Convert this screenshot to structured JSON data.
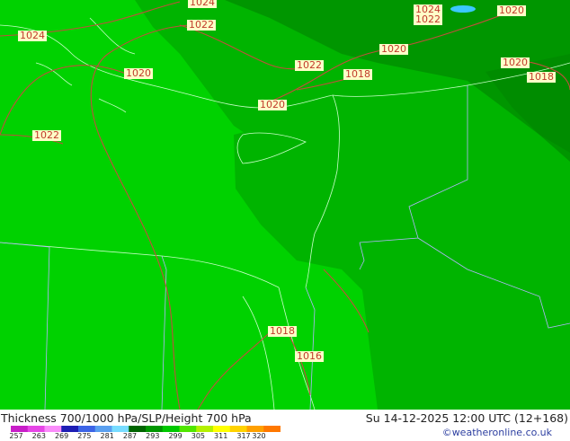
{
  "title": "Thickness 700/1000 hPa/SLP/Height 700 hPa",
  "valid_time": "Su 14-12-2025 12:00 UTC (12+168)",
  "credit": "©weatheronline.co.uk",
  "colors": {
    "land_light": "#00d200",
    "land_mid": "#00b400",
    "land_dark": "#009600",
    "isobar": "#c0503c",
    "border": "#b4b4ff",
    "label_bg": "#ffffc8",
    "label_text": "#c0392b"
  },
  "isobar_labels": [
    {
      "text": "1024",
      "pos": "top-left"
    },
    {
      "text": "1024",
      "pos": "top-center"
    },
    {
      "text": "1022",
      "pos": "top-center"
    },
    {
      "text": "1020",
      "pos": "top-left"
    },
    {
      "text": "1022",
      "pos": "left"
    },
    {
      "text": "1022",
      "pos": "upper-center"
    },
    {
      "text": "1020",
      "pos": "upper-center"
    },
    {
      "text": "1018",
      "pos": "upper-center"
    },
    {
      "text": "1020",
      "pos": "upper-right"
    },
    {
      "text": "1024",
      "pos": "top-right"
    },
    {
      "text": "1022",
      "pos": "top-right"
    },
    {
      "text": "1020",
      "pos": "top-right"
    },
    {
      "text": "1020",
      "pos": "right"
    },
    {
      "text": "1018",
      "pos": "right"
    },
    {
      "text": "1018",
      "pos": "bottom"
    },
    {
      "text": "1016",
      "pos": "bottom"
    }
  ],
  "scale": {
    "ticks": [
      "257",
      "263",
      "269",
      "275",
      "281",
      "287",
      "293",
      "299",
      "305",
      "311",
      "317",
      "320"
    ],
    "colors": [
      "#c81ec8",
      "#e646e6",
      "#fa8cfa",
      "#1e1eb4",
      "#3c64e6",
      "#5aa0f0",
      "#78dcff",
      "#006400",
      "#009600",
      "#00c800",
      "#50e600",
      "#b4f000",
      "#ffff00",
      "#ffd200",
      "#ffa000",
      "#ff7800"
    ]
  }
}
